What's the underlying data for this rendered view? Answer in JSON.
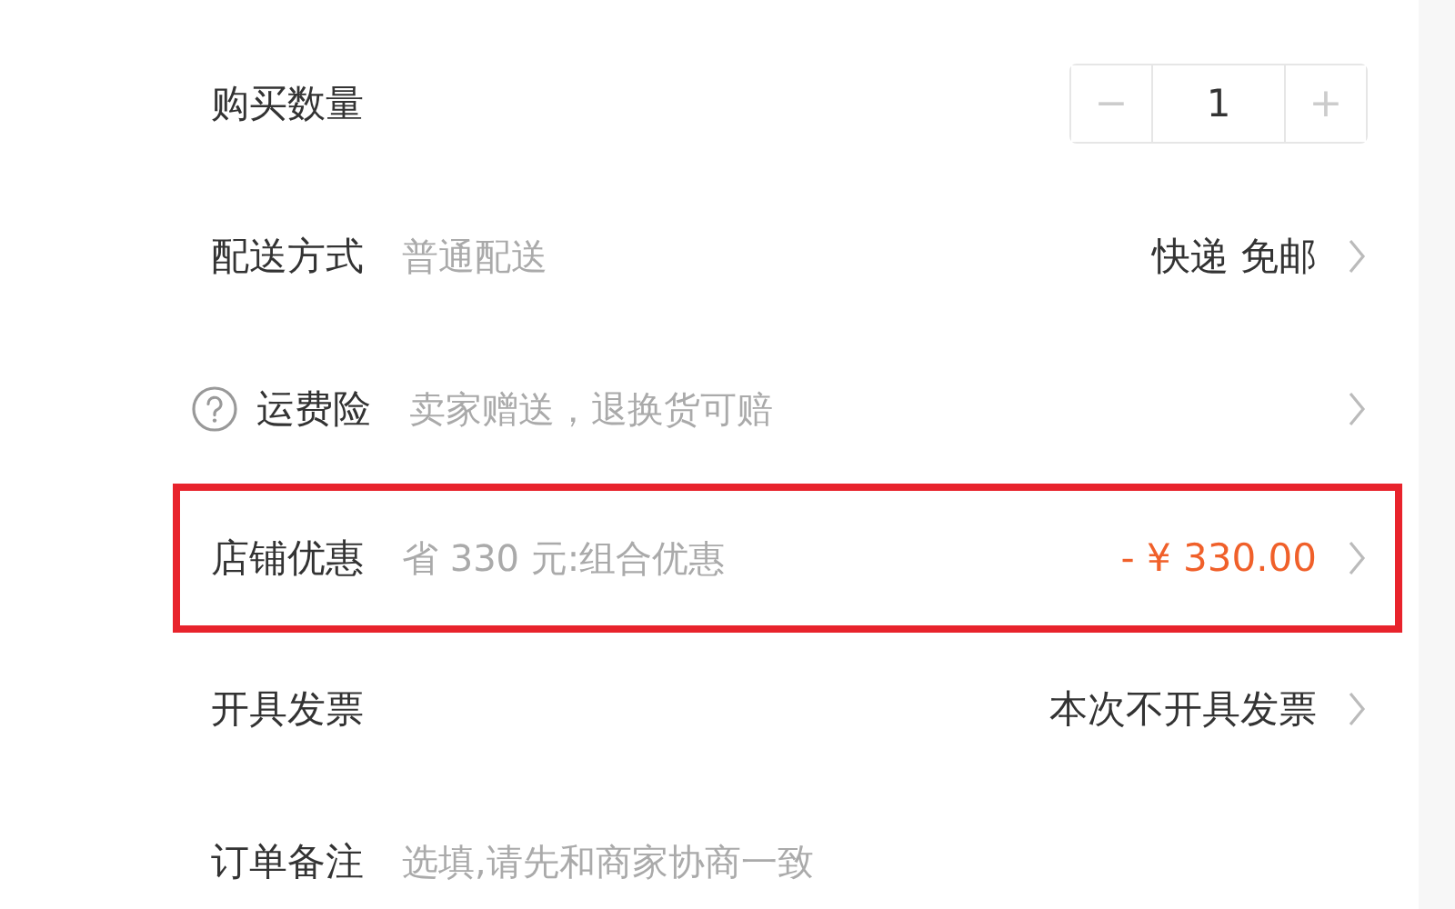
{
  "rows": [
    {
      "kind": "stepper",
      "label": "购买数量",
      "help": false,
      "highlighted": false,
      "quantity": "1",
      "minus": "−",
      "plus": "+"
    },
    {
      "kind": "link",
      "label": "配送方式",
      "help": false,
      "highlighted": false,
      "detail": "普通配送",
      "value": "快递 免邮",
      "discount": false
    },
    {
      "kind": "link",
      "label": "运费险",
      "help": true,
      "highlighted": false,
      "detail": "卖家赠送，退换货可赔"
    },
    {
      "kind": "link",
      "label": "店铺优惠",
      "help": false,
      "highlighted": true,
      "detail": "省 330 元:组合优惠",
      "value": "- ¥ 330.00",
      "discount": true
    },
    {
      "kind": "link",
      "label": "开具发票",
      "help": false,
      "highlighted": false,
      "value": "本次不开具发票",
      "discount": false
    },
    {
      "kind": "note",
      "label": "订单备注",
      "help": false,
      "highlighted": false,
      "placeholder": "选填,请先和商家协商一致"
    }
  ]
}
